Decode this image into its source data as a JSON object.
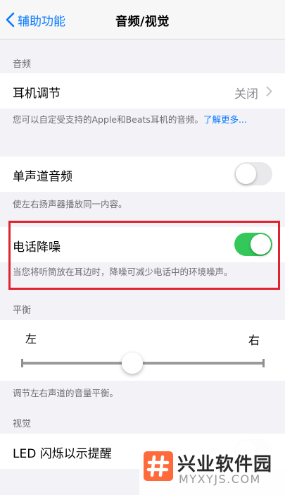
{
  "nav": {
    "back_label": "辅助功能",
    "title": "音频/视觉"
  },
  "audio": {
    "header": "音频",
    "headphone": {
      "label": "耳机调节",
      "value": "关闭"
    },
    "headphone_footer": {
      "text": "您可以自定受支持的Apple和Beats耳机的音频。",
      "link": "了解更多..."
    },
    "mono": {
      "label": "单声道音频",
      "on": false
    },
    "mono_footer": "使左右扬声器播放同一内容。",
    "phone_nc": {
      "label": "电话降噪",
      "on": true
    },
    "phone_nc_footer": "当您将听筒放在耳边时，降噪可减少电话中的环境噪声。"
  },
  "balance": {
    "header": "平衡",
    "left_label": "左",
    "right_label": "右",
    "value": 0.5,
    "footer": "调节左右声道的音量平衡。"
  },
  "visual": {
    "header": "视觉",
    "led": {
      "label": "LED 闪烁以示提醒"
    }
  },
  "watermark": {
    "name": "兴业软件园",
    "domain": "MYXYJS.COM"
  },
  "colors": {
    "accent": "#0a7aff",
    "toggle_on": "#34c759",
    "highlight": "#e0232c"
  }
}
